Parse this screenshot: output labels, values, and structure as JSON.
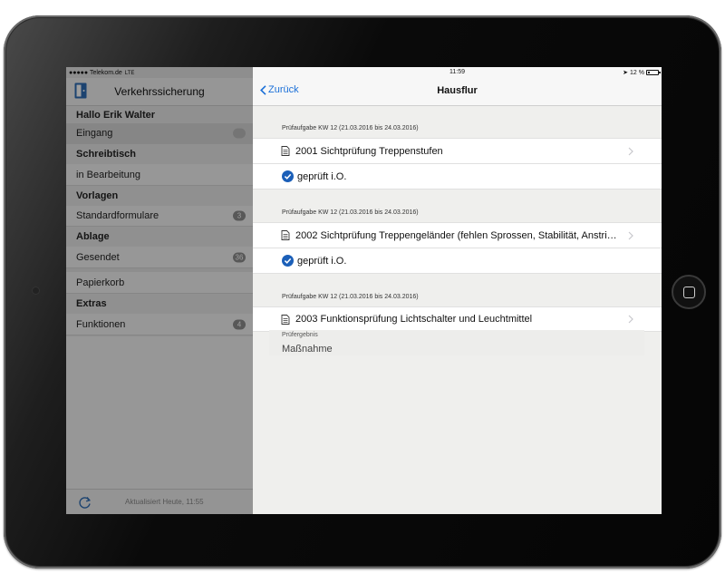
{
  "status_bar": {
    "carrier": "●●●●● Telekom.de",
    "network": "LTE",
    "time": "11:59",
    "battery": "12 %"
  },
  "sidebar": {
    "title": "Verkehrssicherung",
    "greeting": "Hallo Erik Walter",
    "rows": [
      {
        "type": "item",
        "label": "Eingang",
        "badge": "",
        "selected": true
      },
      {
        "type": "section",
        "label": "Schreibtisch"
      },
      {
        "type": "item",
        "label": "in Bearbeitung",
        "badge": ""
      },
      {
        "type": "section",
        "label": "Vorlagen"
      },
      {
        "type": "item",
        "label": "Standardformulare",
        "badge": "3"
      },
      {
        "type": "section",
        "label": "Ablage"
      },
      {
        "type": "item",
        "label": "Gesendet",
        "badge": "36"
      },
      {
        "type": "item",
        "label": "Papierkorb",
        "badge": ""
      },
      {
        "type": "section",
        "label": "Extras"
      },
      {
        "type": "item",
        "label": "Funktionen",
        "badge": "4"
      }
    ],
    "footer": {
      "updated": "Aktualisiert Heute, 11:55"
    }
  },
  "main": {
    "back_label": "Zurück",
    "title": "Hausflur",
    "groups": [
      {
        "header": "Prüfaufgabe KW 12 (21.03.2016 bis 24.03.2016)",
        "task": "2001 Sichtprüfung Treppenstufen",
        "result": "geprüft i.O."
      },
      {
        "header": "Prüfaufgabe KW 12 (21.03.2016 bis 24.03.2016)",
        "task": "2002 Sichtprüfung Treppengeländer (fehlen Sprossen, Stabilität, Anstri…",
        "result": "geprüft i.O."
      },
      {
        "header": "Prüfaufgabe KW 12 (21.03.2016 bis 24.03.2016)",
        "task": "2003 Funktionsprüfung Lichtschalter und Leuchtmittel",
        "result_label": "Prüfergebnis",
        "result_field": "Maßnahme"
      }
    ]
  },
  "colors": {
    "accent": "#1a6fd8",
    "check": "#1b5fb8"
  }
}
